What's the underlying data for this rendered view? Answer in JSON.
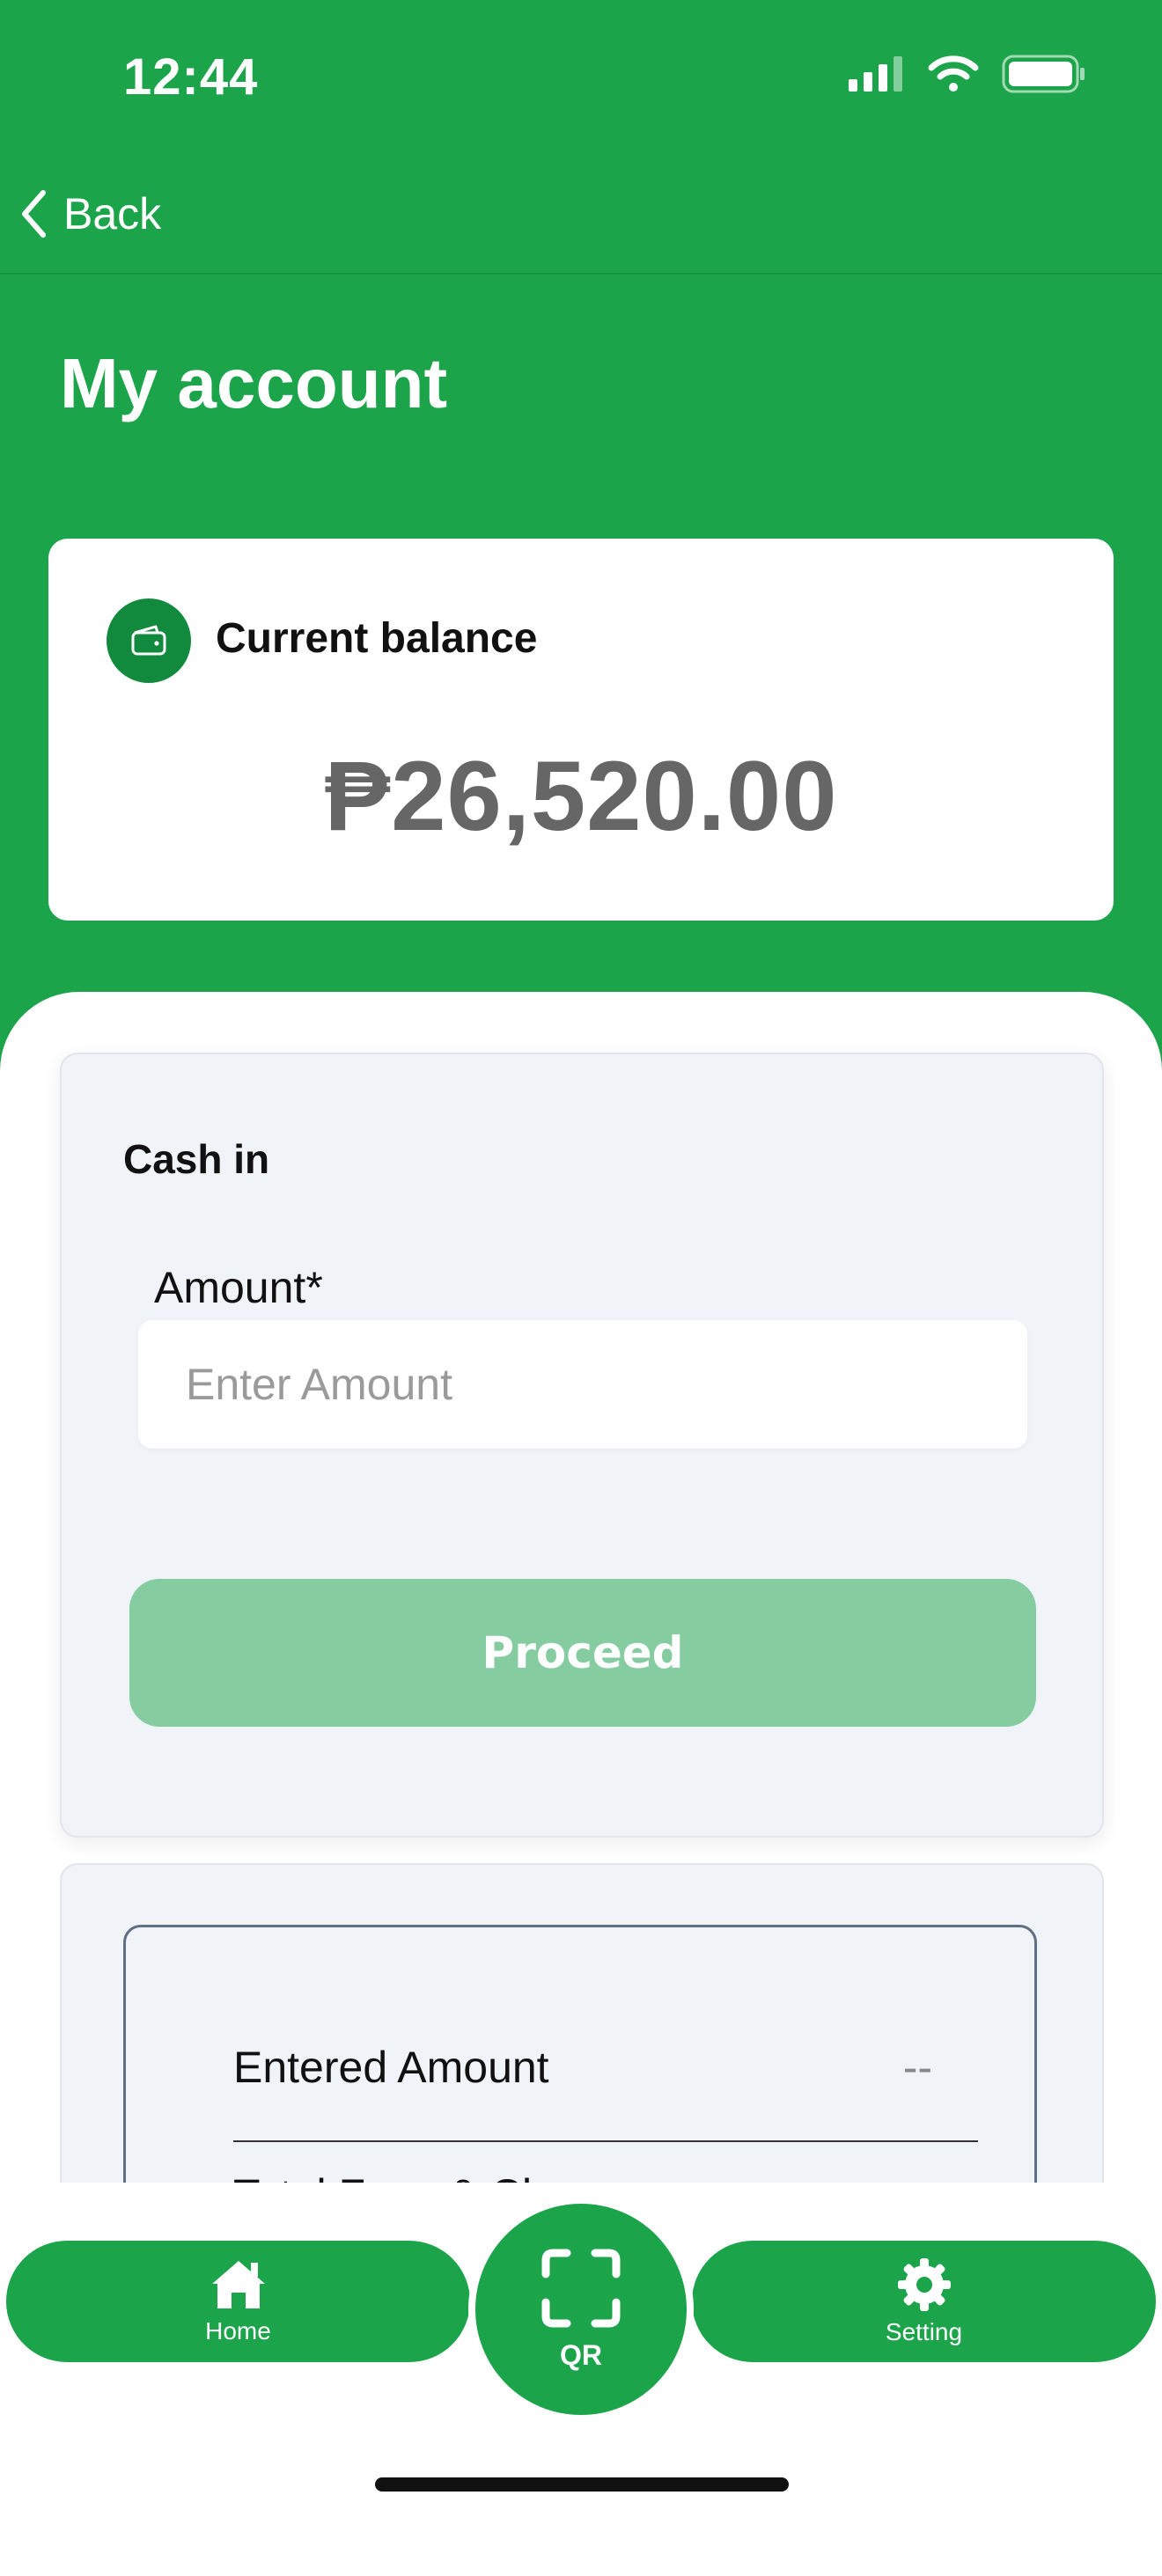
{
  "status_bar": {
    "time": "12:44"
  },
  "nav": {
    "back_label": "Back"
  },
  "page": {
    "title": "My account"
  },
  "balance": {
    "label": "Current balance",
    "amount": "₱26,520.00"
  },
  "cash_in": {
    "title": "Cash in",
    "amount_label": "Amount*",
    "amount_value": "",
    "amount_placeholder": "Enter Amount",
    "proceed_label": "Proceed"
  },
  "summary": {
    "rows": [
      {
        "label": "Entered Amount",
        "value": "--"
      },
      {
        "label": "Total Fees & Charges",
        "value": ""
      }
    ]
  },
  "tab_bar": {
    "home_label": "Home",
    "qr_label": "QR",
    "setting_label": "Setting"
  },
  "colors": {
    "brand_green": "#1ba44a",
    "brand_green_dark": "#128a3d",
    "proceed_disabled": "#86cca1",
    "card_bg": "#f0f3f8"
  },
  "icons": {
    "back": "chevron-left-icon",
    "wallet": "wallet-icon",
    "home": "home-icon",
    "qr": "qr-scan-icon",
    "setting": "gear-icon"
  }
}
